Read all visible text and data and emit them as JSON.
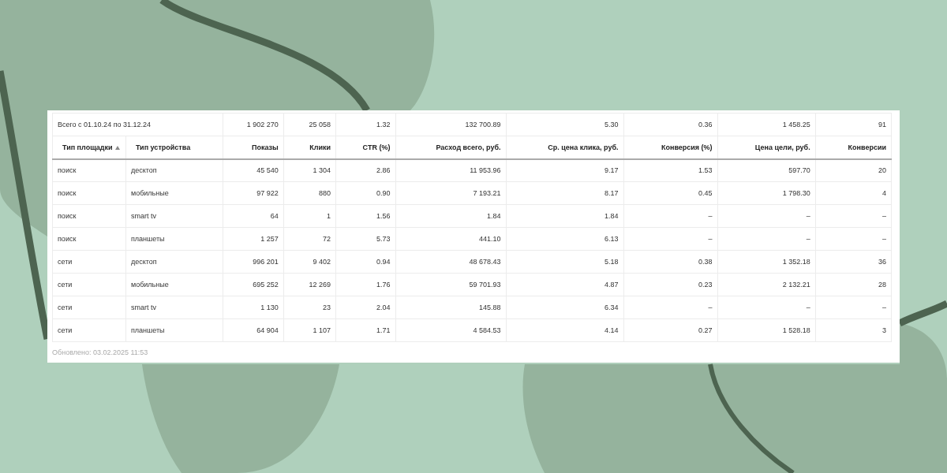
{
  "total": {
    "label": "Всего с 01.10.24 по 31.12.24",
    "values": [
      "1 902 270",
      "25 058",
      "1.32",
      "132 700.89",
      "5.30",
      "0.36",
      "1 458.25",
      "91"
    ]
  },
  "columns": [
    {
      "label": "Тип площадки",
      "sorted": true
    },
    {
      "label": "Тип устройства",
      "sorted": false
    },
    {
      "label": "Показы",
      "sorted": false
    },
    {
      "label": "Клики",
      "sorted": false
    },
    {
      "label": "CTR (%)",
      "sorted": false
    },
    {
      "label": "Расход всего, руб.",
      "sorted": false
    },
    {
      "label": "Ср. цена клика, руб.",
      "sorted": false
    },
    {
      "label": "Конверсия (%)",
      "sorted": false
    },
    {
      "label": "Цена цели, руб.",
      "sorted": false
    },
    {
      "label": "Конверсии",
      "sorted": false
    }
  ],
  "rows": [
    [
      "поиск",
      "десктоп",
      "45 540",
      "1 304",
      "2.86",
      "11 953.96",
      "9.17",
      "1.53",
      "597.70",
      "20"
    ],
    [
      "поиск",
      "мобильные",
      "97 922",
      "880",
      "0.90",
      "7 193.21",
      "8.17",
      "0.45",
      "1 798.30",
      "4"
    ],
    [
      "поиск",
      "smart tv",
      "64",
      "1",
      "1.56",
      "1.84",
      "1.84",
      "–",
      "–",
      "–"
    ],
    [
      "поиск",
      "планшеты",
      "1 257",
      "72",
      "5.73",
      "441.10",
      "6.13",
      "–",
      "–",
      "–"
    ],
    [
      "сети",
      "десктоп",
      "996 201",
      "9 402",
      "0.94",
      "48 678.43",
      "5.18",
      "0.38",
      "1 352.18",
      "36"
    ],
    [
      "сети",
      "мобильные",
      "695 252",
      "12 269",
      "1.76",
      "59 701.93",
      "4.87",
      "0.23",
      "2 132.21",
      "28"
    ],
    [
      "сети",
      "smart tv",
      "1 130",
      "23",
      "2.04",
      "145.88",
      "6.34",
      "–",
      "–",
      "–"
    ],
    [
      "сети",
      "планшеты",
      "64 904",
      "1 107",
      "1.71",
      "4 584.53",
      "4.14",
      "0.27",
      "1 528.18",
      "3"
    ]
  ],
  "footer": "Обновлено: 03.02.2025 11:53"
}
